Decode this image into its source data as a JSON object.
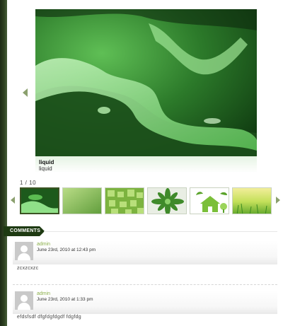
{
  "gallery": {
    "title": "liquid",
    "description": "liquid",
    "counter": "1 / 10",
    "thumbnails": [
      "liquid",
      "green gradient",
      "green tiles",
      "succulent",
      "eco house",
      "green meadow"
    ]
  },
  "comments": {
    "heading": "COMMENTS",
    "items": [
      {
        "author": "admin",
        "date": "June 23rd, 2010 at 12:43 pm",
        "text": "zcxzcxzc"
      },
      {
        "author": "admin",
        "date": "June 23rd, 2010 at 1:33 pm",
        "text": "efdsfsdf dfgfdgfdgdf fdgfdg"
      }
    ]
  },
  "colors": {
    "accent": "#1e3a12",
    "author": "#8bb04a",
    "arrow": "#8ba06e"
  }
}
